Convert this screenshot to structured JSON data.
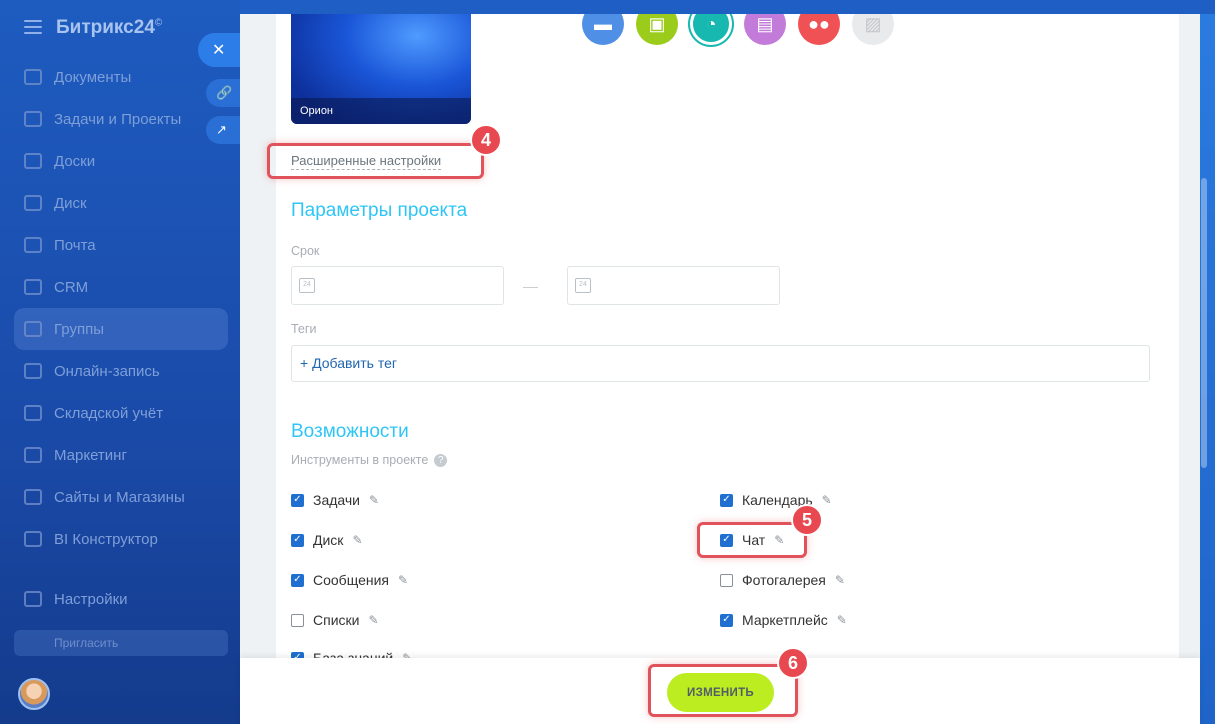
{
  "app": {
    "name": "Битрикс24",
    "trademark": "©"
  },
  "sidebar": {
    "items": [
      {
        "label": "Документы",
        "icon": "document-icon",
        "active": false
      },
      {
        "label": "Задачи и Проекты",
        "icon": "tasks-icon",
        "active": false
      },
      {
        "label": "Доски",
        "icon": "boards-icon",
        "active": false
      },
      {
        "label": "Диск",
        "icon": "disk-icon",
        "active": false
      },
      {
        "label": "Почта",
        "icon": "mail-icon",
        "active": false
      },
      {
        "label": "CRM",
        "icon": "crm-icon",
        "active": false
      },
      {
        "label": "Группы",
        "icon": "groups-icon",
        "active": true
      },
      {
        "label": "Онлайн-запись",
        "icon": "calendar-icon",
        "active": false
      },
      {
        "label": "Складской учёт",
        "icon": "warehouse-icon",
        "active": false
      },
      {
        "label": "Маркетинг",
        "icon": "marketing-icon",
        "active": false
      },
      {
        "label": "Сайты и Магазины",
        "icon": "cart-icon",
        "active": false
      },
      {
        "label": "BI Конструктор",
        "icon": "chart-icon",
        "active": false
      }
    ],
    "settings_label": "Настройки",
    "bottom_button_label": "Пригласить"
  },
  "slider": {
    "cover_label": "Орион",
    "advanced_settings_link": "Расширенные настройки",
    "project_params_title": "Параметры проекта",
    "term_label": "Срок",
    "date_icon_text": "24",
    "tags_label": "Теги",
    "add_tag_label": "+ Добавить тег",
    "features_title": "Возможности",
    "tools_label": "Инструменты в проекте",
    "help_glyph": "?",
    "features_left": [
      {
        "label": "Задачи",
        "checked": true
      },
      {
        "label": "Диск",
        "checked": true
      },
      {
        "label": "Сообщения",
        "checked": true
      },
      {
        "label": "Списки",
        "checked": false
      },
      {
        "label": "База знаний",
        "checked": true
      }
    ],
    "features_right": [
      {
        "label": "Календарь",
        "checked": true
      },
      {
        "label": "Чат",
        "checked": true
      },
      {
        "label": "Фотогалерея",
        "checked": false
      },
      {
        "label": "Маркетплейс",
        "checked": true
      }
    ],
    "save_button_label": "ИЗМЕНИТЬ"
  },
  "annotations": {
    "step4": "4",
    "step5": "5",
    "step6": "6"
  },
  "colors": {
    "accent_title": "#2fc6f6",
    "save_button": "#bbed21",
    "highlight": "#e0535a",
    "checkbox": "#1e6fd0"
  }
}
